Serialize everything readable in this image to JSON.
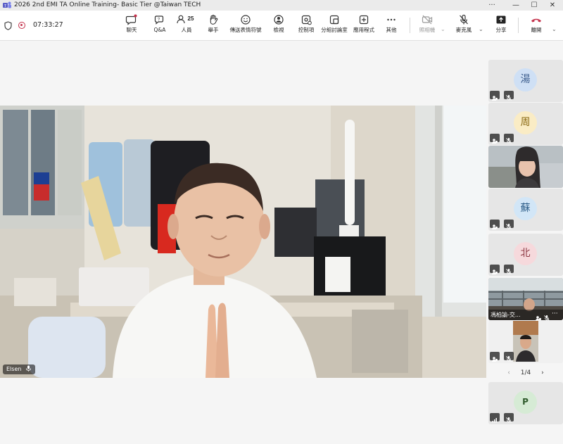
{
  "window": {
    "title": "2026 2nd EMI TA Online Training- Basic Tier @Taiwan TECH",
    "minimize": "—",
    "maximize": "☐",
    "close": "✕",
    "more": "···"
  },
  "toolbar": {
    "timer": "07:33:27",
    "chat": "聊天",
    "qa": "Q&A",
    "people": "人員",
    "people_count": "25",
    "raise_hand": "舉手",
    "react": "傳送表情符號",
    "view": "檢視",
    "controls": "控制項",
    "breakout": "分組討論室",
    "apps": "應用程式",
    "more": "其他",
    "camera": "照相機",
    "mic": "麥克風",
    "share": "分享",
    "leave": "離開"
  },
  "main_video": {
    "participant_name": "Elsen"
  },
  "rail": {
    "tiles": [
      {
        "avatar_text": "湯",
        "avatar_bg": "#cfe0f5",
        "avatar_color": "#3b5c8c"
      },
      {
        "avatar_text": "周",
        "avatar_bg": "#faecc5",
        "avatar_color": "#8a6a14"
      },
      {
        "video": true
      },
      {
        "avatar_text": "蘇",
        "avatar_bg": "#d2e6f7",
        "avatar_color": "#2f5f8a"
      },
      {
        "avatar_text": "北",
        "avatar_bg": "#f6d9dc",
        "avatar_color": "#8f3a45"
      },
      {
        "video": true,
        "name": "馮柏諭-交..."
      },
      {
        "video": true
      },
      {
        "avatar_text": "P",
        "avatar_bg": "#d6ebd5",
        "avatar_color": "#2f5b2c"
      }
    ],
    "pager": "1/4",
    "pager_prev": "‹",
    "pager_next": "›"
  },
  "colors": {
    "leave_red": "#c4314b",
    "accent": "#5b5fc7"
  },
  "icons": {
    "chat": "chat-icon",
    "qa": "qa-icon",
    "people": "people-icon",
    "raise_hand": "hand-icon",
    "react": "smiley-icon",
    "view": "view-icon",
    "controls": "controls-icon",
    "breakout": "breakout-icon",
    "apps": "plus-icon",
    "more": "ellipsis-icon",
    "camera": "camera-off-icon",
    "mic": "mic-off-icon",
    "share": "share-icon",
    "leave": "phone-icon"
  }
}
